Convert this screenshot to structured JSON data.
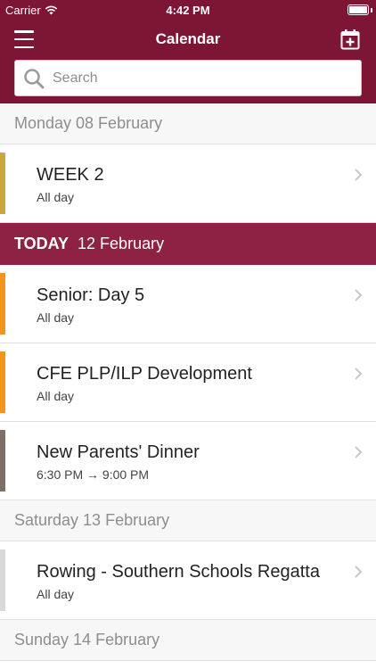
{
  "status_bar": {
    "carrier": "Carrier",
    "time": "4:42 PM"
  },
  "navbar": {
    "title": "Calendar",
    "menu_icon": "hamburger-icon",
    "add_icon": "calendar-add-icon"
  },
  "search": {
    "placeholder": "Search",
    "value": ""
  },
  "colors": {
    "header": "#7d1535",
    "today_header": "#8d2244"
  },
  "sections": [
    {
      "date": "Monday 08 February",
      "events": [
        {
          "title": "WEEK 2",
          "time": "All day",
          "color": "#c9a93a"
        }
      ]
    },
    {
      "today_label": "TODAY",
      "date": "12 February",
      "events": [
        {
          "title": "Senior: Day 5",
          "time": "All day",
          "color": "#f5941d"
        },
        {
          "title": "CFE PLP/ILP Development",
          "time": "All day",
          "color": "#f5941d"
        },
        {
          "title": "New Parents' Dinner",
          "time": "6:30 PM → 9:00 PM",
          "color": "#7d6e66"
        }
      ]
    },
    {
      "date": "Saturday 13 February",
      "events": [
        {
          "title": "Rowing - Southern Schools Regatta",
          "time": "All day",
          "color": "#d9d9d9"
        }
      ]
    },
    {
      "date": "Sunday 14 February",
      "events": []
    }
  ]
}
